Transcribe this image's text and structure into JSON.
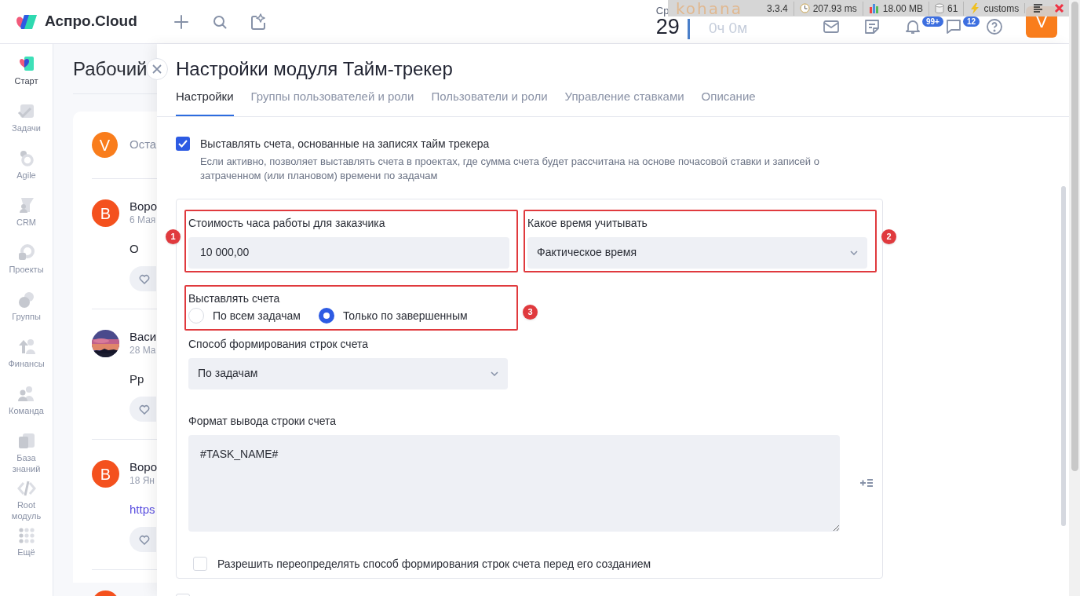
{
  "header": {
    "logo": "Аспро.Cloud",
    "weekday": "Ср",
    "day": "29",
    "timer": "0ч 0м",
    "notifications_badge": "99+",
    "messages_badge": "12",
    "avatar": "V"
  },
  "debug_bar": {
    "logo": "kohana",
    "items": [
      {
        "kind": "version",
        "text": "3.3.4"
      },
      {
        "kind": "time",
        "text": "207.93 ms"
      },
      {
        "kind": "memory",
        "text": "18.00 MB"
      },
      {
        "kind": "queries",
        "text": "61"
      },
      {
        "kind": "env",
        "text": "customs"
      }
    ]
  },
  "sidebar": {
    "items": [
      {
        "label": "Старт",
        "selected": true
      },
      {
        "label": "Задачи",
        "selected": false
      },
      {
        "label": "Agile",
        "selected": false
      },
      {
        "label": "CRM",
        "selected": false
      },
      {
        "label": "Проекты",
        "selected": false
      },
      {
        "label": "Группы",
        "selected": false
      },
      {
        "label": "Финансы",
        "selected": false
      },
      {
        "label": "Команда",
        "selected": false
      },
      {
        "label": "База знаний",
        "selected": false
      },
      {
        "label": "Root модуль",
        "selected": false
      },
      {
        "label": "Ещё",
        "selected": false
      }
    ]
  },
  "page": {
    "title": "Рабочий",
    "composer": {
      "avatar": "V",
      "text": "Оста"
    },
    "posts": [
      {
        "avatar": {
          "kind": "letter",
          "text": "В"
        },
        "author": "Воро",
        "date": "6 Мая",
        "body": {
          "kind": "text",
          "text": "О"
        }
      },
      {
        "author": "Васи",
        "date": "28 Ма",
        "body": {
          "kind": "text",
          "text": "Рр"
        }
      },
      {
        "avatar": {
          "kind": "letter",
          "text": "В"
        },
        "author": "Воро",
        "date": "18 Ян",
        "body": {
          "kind": "link",
          "text": "https"
        }
      },
      {
        "avatar": {
          "kind": "blank"
        }
      }
    ]
  },
  "modal": {
    "title": "Настройки модуля Тайм-трекер",
    "tabs": [
      {
        "label": "Настройки",
        "selected": true
      },
      {
        "label": "Группы пользователей и роли",
        "selected": false
      },
      {
        "label": "Пользователи и роли",
        "selected": false
      },
      {
        "label": "Управление ставками",
        "selected": false
      },
      {
        "label": "Описание",
        "selected": false
      }
    ],
    "invoice_option": {
      "label": "Выставлять счета, основанные на записях тайм трекера",
      "checked": true,
      "description": "Если активно, позволяет выставлять счета в проектах, где сумма счета будет рассчитана на основе почасовой ставки и записей о затраченном (или плановом) времени по задачам"
    },
    "fields": [
      {
        "kind": "input",
        "label": "Стоимость часа работы для заказчика",
        "value": "10 000,00",
        "annotation": "1"
      },
      {
        "kind": "select",
        "label": "Какое время учитывать",
        "value": "Фактическое время",
        "annotation": "2"
      },
      {
        "kind": "radio",
        "label": "Выставлять счета",
        "annotation": "3",
        "options": [
          {
            "label": "По всем задачам",
            "selected": false
          },
          {
            "label": "Только по завершенным",
            "selected": true
          }
        ]
      },
      {
        "kind": "select",
        "label": "Способ формирования строк счета",
        "value": "По задачам"
      },
      {
        "kind": "textarea",
        "label": "Формат вывода строки счета",
        "value": "#TASK_NAME#"
      },
      {
        "kind": "checkbox",
        "label": "Разрешить переопределять способ формирования строк счета перед его созданием",
        "checked": false
      }
    ],
    "next_option": {
      "checked": false
    }
  }
}
